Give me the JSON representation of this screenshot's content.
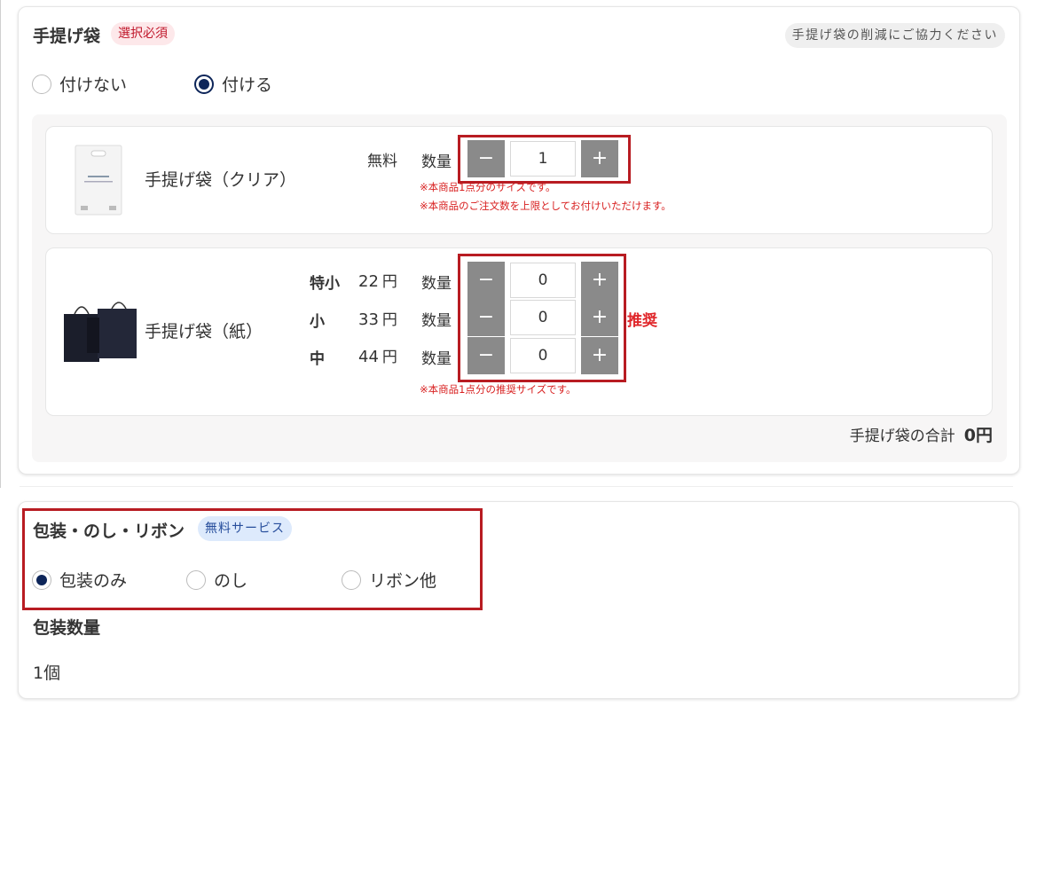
{
  "bag": {
    "title": "手提げ袋",
    "required_badge": "選択必須",
    "note": "手提げ袋の削減にご協力ください",
    "options": [
      "付けない",
      "付ける"
    ],
    "selected_option": "付ける",
    "clear": {
      "name": "手提げ袋（クリア）",
      "price": "無料",
      "qty_label": "数量",
      "quantity": "1",
      "note1": "※本商品1点分のサイズです。",
      "note2": "※本商品のご注文数を上限としてお付けいただけます。"
    },
    "paper": {
      "name": "手提げ袋（紙）",
      "sizes": [
        {
          "label": "特小",
          "price": "22",
          "unit": "円",
          "qty_label": "数量",
          "quantity": "0"
        },
        {
          "label": "小",
          "price": "33",
          "unit": "円",
          "qty_label": "数量",
          "quantity": "0"
        },
        {
          "label": "中",
          "price": "44",
          "unit": "円",
          "qty_label": "数量",
          "quantity": "0"
        }
      ],
      "recommended": "推奨",
      "note": "※本商品1点分の推奨サイズです。"
    },
    "total_label": "手提げ袋の合計",
    "total_value": "0円",
    "minus": "−",
    "plus": "+"
  },
  "wrapping": {
    "title": "包装・のし・リボン",
    "badge": "無料サービス",
    "options": [
      "包装のみ",
      "のし",
      "リボン他"
    ],
    "selected_option": "包装のみ",
    "qty_title": "包装数量",
    "qty_value": "1個"
  },
  "colors": {
    "accent": "#0d2559",
    "required": "#c0172b",
    "highlight_frame": "#b81c22",
    "stepper": "#8a8a8a"
  }
}
